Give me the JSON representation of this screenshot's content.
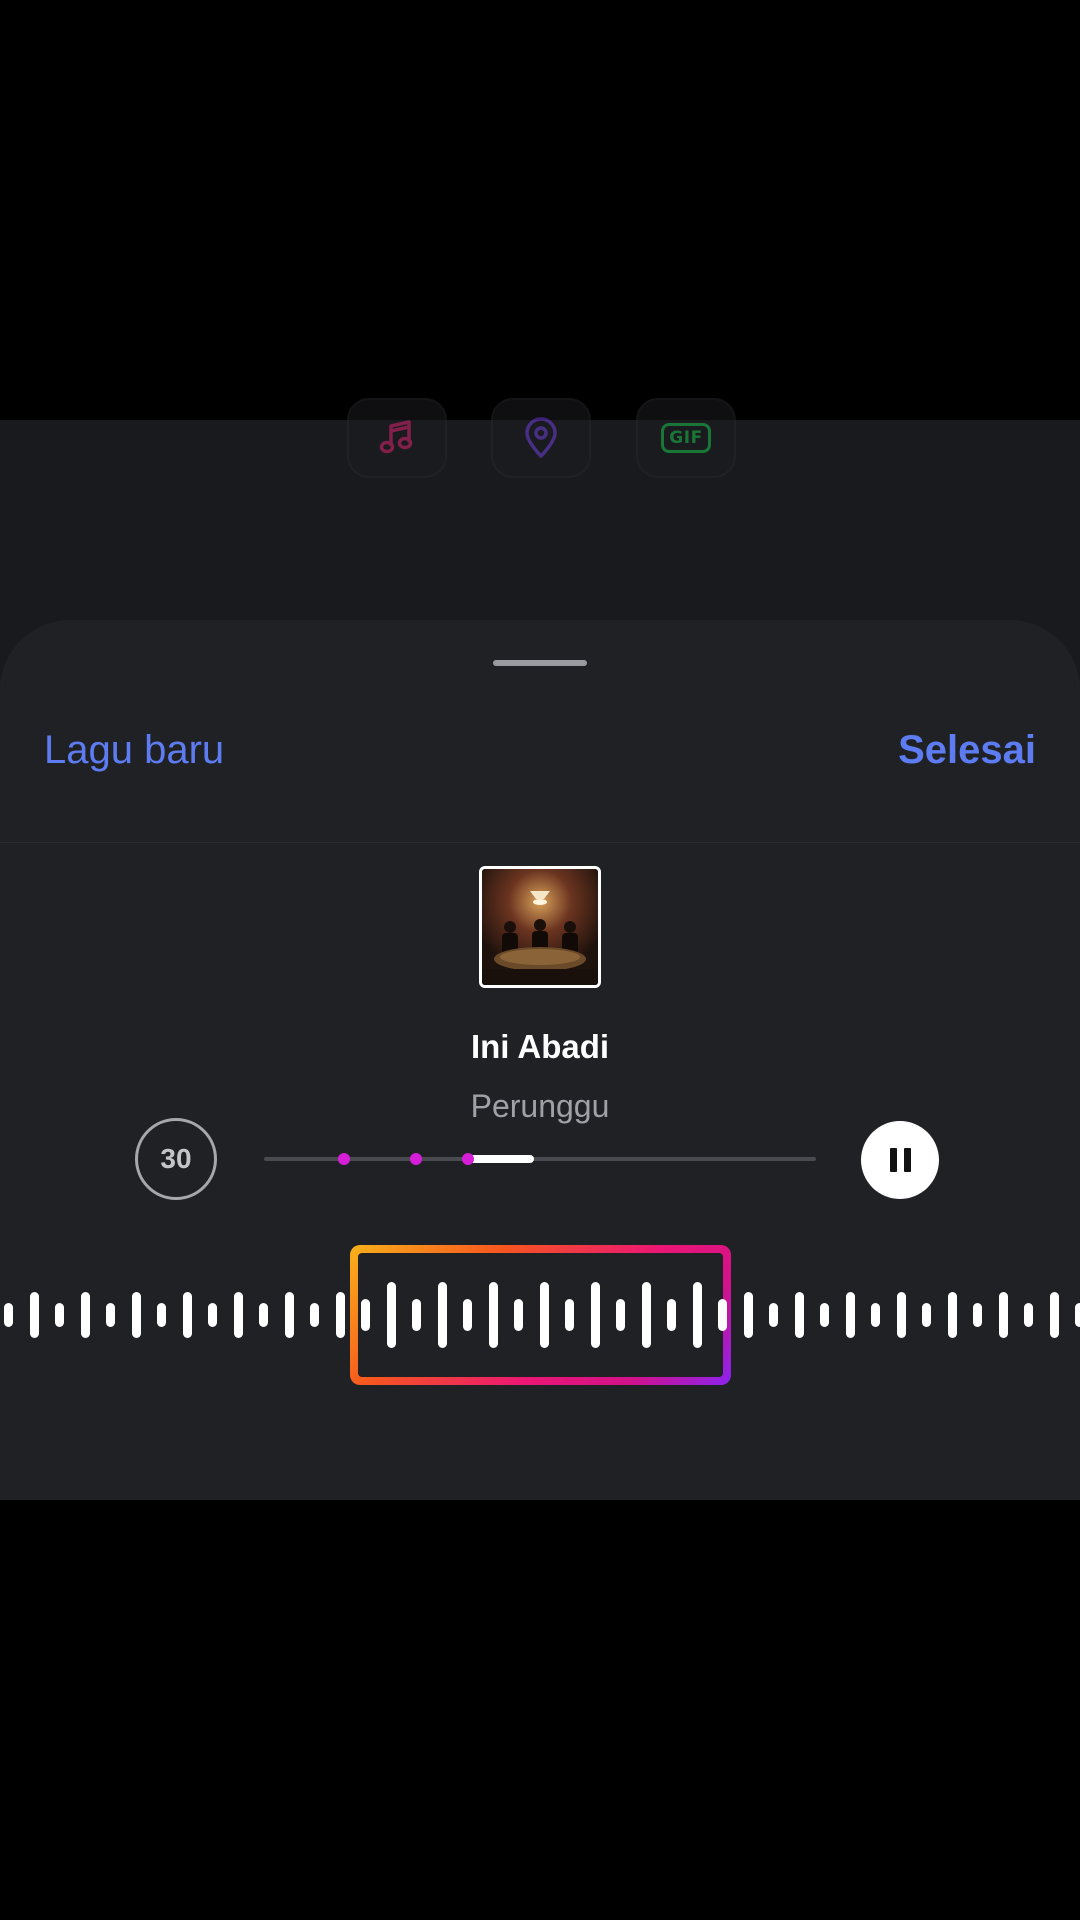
{
  "header": {
    "left_label": "Lagu baru",
    "right_label": "Selesai"
  },
  "song": {
    "title": "Ini Abadi",
    "artist": "Perunggu"
  },
  "player": {
    "duration": "30",
    "progress_fraction": 0.12,
    "state": "playing"
  },
  "stickers": [
    {
      "icon": "music-note-icon",
      "color": "#d8246e"
    },
    {
      "icon": "location-pin-icon",
      "color": "#6f3fd8"
    },
    {
      "label": "GIF",
      "color": "#19c24a"
    }
  ],
  "colors": {
    "accent": "#5e7cf2",
    "sheet": "#202125",
    "marker": "#d61ed8",
    "selector_gradient": [
      "#f9b21a",
      "#f6561f",
      "#ec1674",
      "#8a23f0"
    ]
  }
}
